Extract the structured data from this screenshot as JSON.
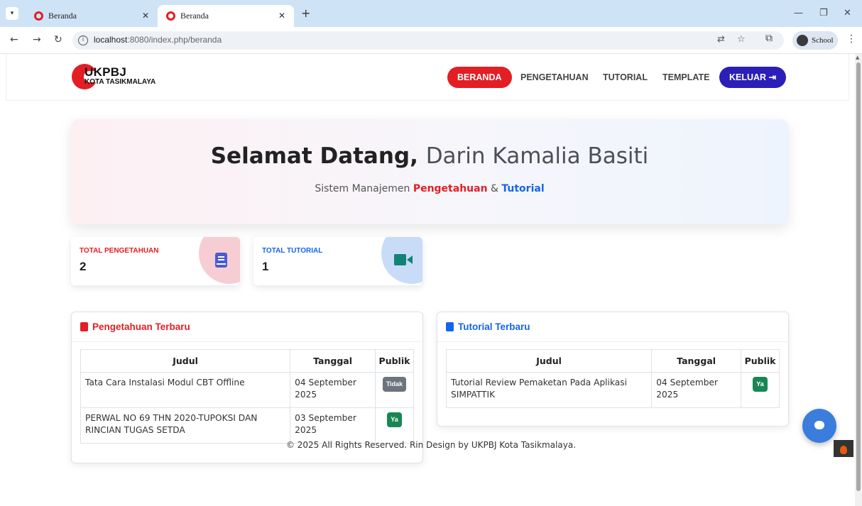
{
  "browser": {
    "tabs": [
      {
        "title": "Beranda",
        "active": false
      },
      {
        "title": "Beranda",
        "active": true
      }
    ],
    "url_host": "localhost",
    "url_rest": ":8080/index.php/beranda",
    "profile_label": "School"
  },
  "site": {
    "logo_title": "UKPBJ",
    "logo_subtitle": "KOTA TASIKMALAYA",
    "nav": {
      "home": "BERANDA",
      "knowledge": "PENGETAHUAN",
      "tutorial": "TUTORIAL",
      "template": "TEMPLATE",
      "logout": "KELUAR"
    },
    "colors": {
      "brand_red": "#e31e24",
      "logout_indigo": "#2b1fb8",
      "accent_blue": "#1565e8"
    }
  },
  "hero": {
    "greeting": "Selamat Datang,",
    "user_name": "Darin Kamalia Basiti",
    "sub_prefix": "Sistem Manajemen",
    "sub_knowledge": "Pengetahuan",
    "sub_amp": "&",
    "sub_tutorial": "Tutorial"
  },
  "stats": [
    {
      "label": "TOTAL PENGETAHUAN",
      "value": "2",
      "icon": "book-icon"
    },
    {
      "label": "TOTAL TUTORIAL",
      "value": "1",
      "icon": "video-camera-icon"
    }
  ],
  "knowledge_panel": {
    "title": "Pengetahuan Terbaru",
    "columns": [
      "Judul",
      "Tanggal",
      "Publik"
    ],
    "rows": [
      {
        "title": "Tata Cara Instalasi Modul CBT Offline",
        "date": "04 September 2025",
        "public": "Tidak"
      },
      {
        "title": "PERWAL NO 69 THN 2020-TUPOKSI DAN RINCIAN TUGAS SETDA",
        "date": "03 September 2025",
        "public": "Ya"
      }
    ]
  },
  "tutorial_panel": {
    "title": "Tutorial Terbaru",
    "columns": [
      "Judul",
      "Tanggal",
      "Publik"
    ],
    "rows": [
      {
        "title": "Tutorial Review Pemaketan Pada Aplikasi SIMPATTIK",
        "date": "04 September 2025",
        "public": "Ya"
      }
    ]
  },
  "footer": {
    "text": "© 2025 All Rights Reserved. Rin Design by UKPBJ Kota Tasikmalaya."
  }
}
